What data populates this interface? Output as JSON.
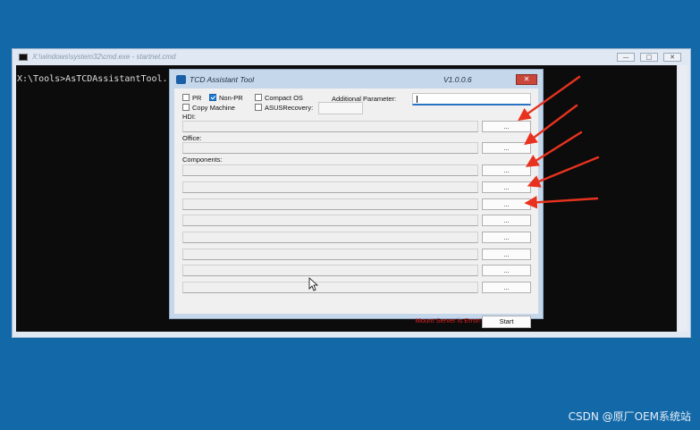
{
  "cmd_window": {
    "title": "X:\\windows\\system32\\cmd.exe - startnet.cmd",
    "prompt_line": "X:\\Tools>AsTCDAssistantTool.",
    "controls": [
      "—",
      "□",
      "✕"
    ]
  },
  "dialog": {
    "title": "TCD Assistant Tool",
    "version": "V1.0.0.6",
    "close_label": "✕",
    "options": {
      "pr": {
        "label": "PR",
        "checked": false
      },
      "non_pr": {
        "label": "Non-PR",
        "checked": true
      },
      "compact_os": {
        "label": "Compact OS",
        "checked": false
      },
      "copy_machine": {
        "label": "Copy Machine",
        "checked": false
      },
      "asus_recovery": {
        "label": "ASUSRecovery:",
        "checked": false
      }
    },
    "additional_parameter_label": "Additional Parameter:",
    "additional_parameter_value": "",
    "sections": {
      "hdi": "HDI:",
      "office": "Office:",
      "components": "Components:"
    },
    "browse_label": "...",
    "error_text": "Mount Server is Error!",
    "start_label": "Start"
  },
  "annotations": {
    "arrow_color": "#e8321f"
  },
  "watermark": "CSDN @原厂OEM系统站"
}
